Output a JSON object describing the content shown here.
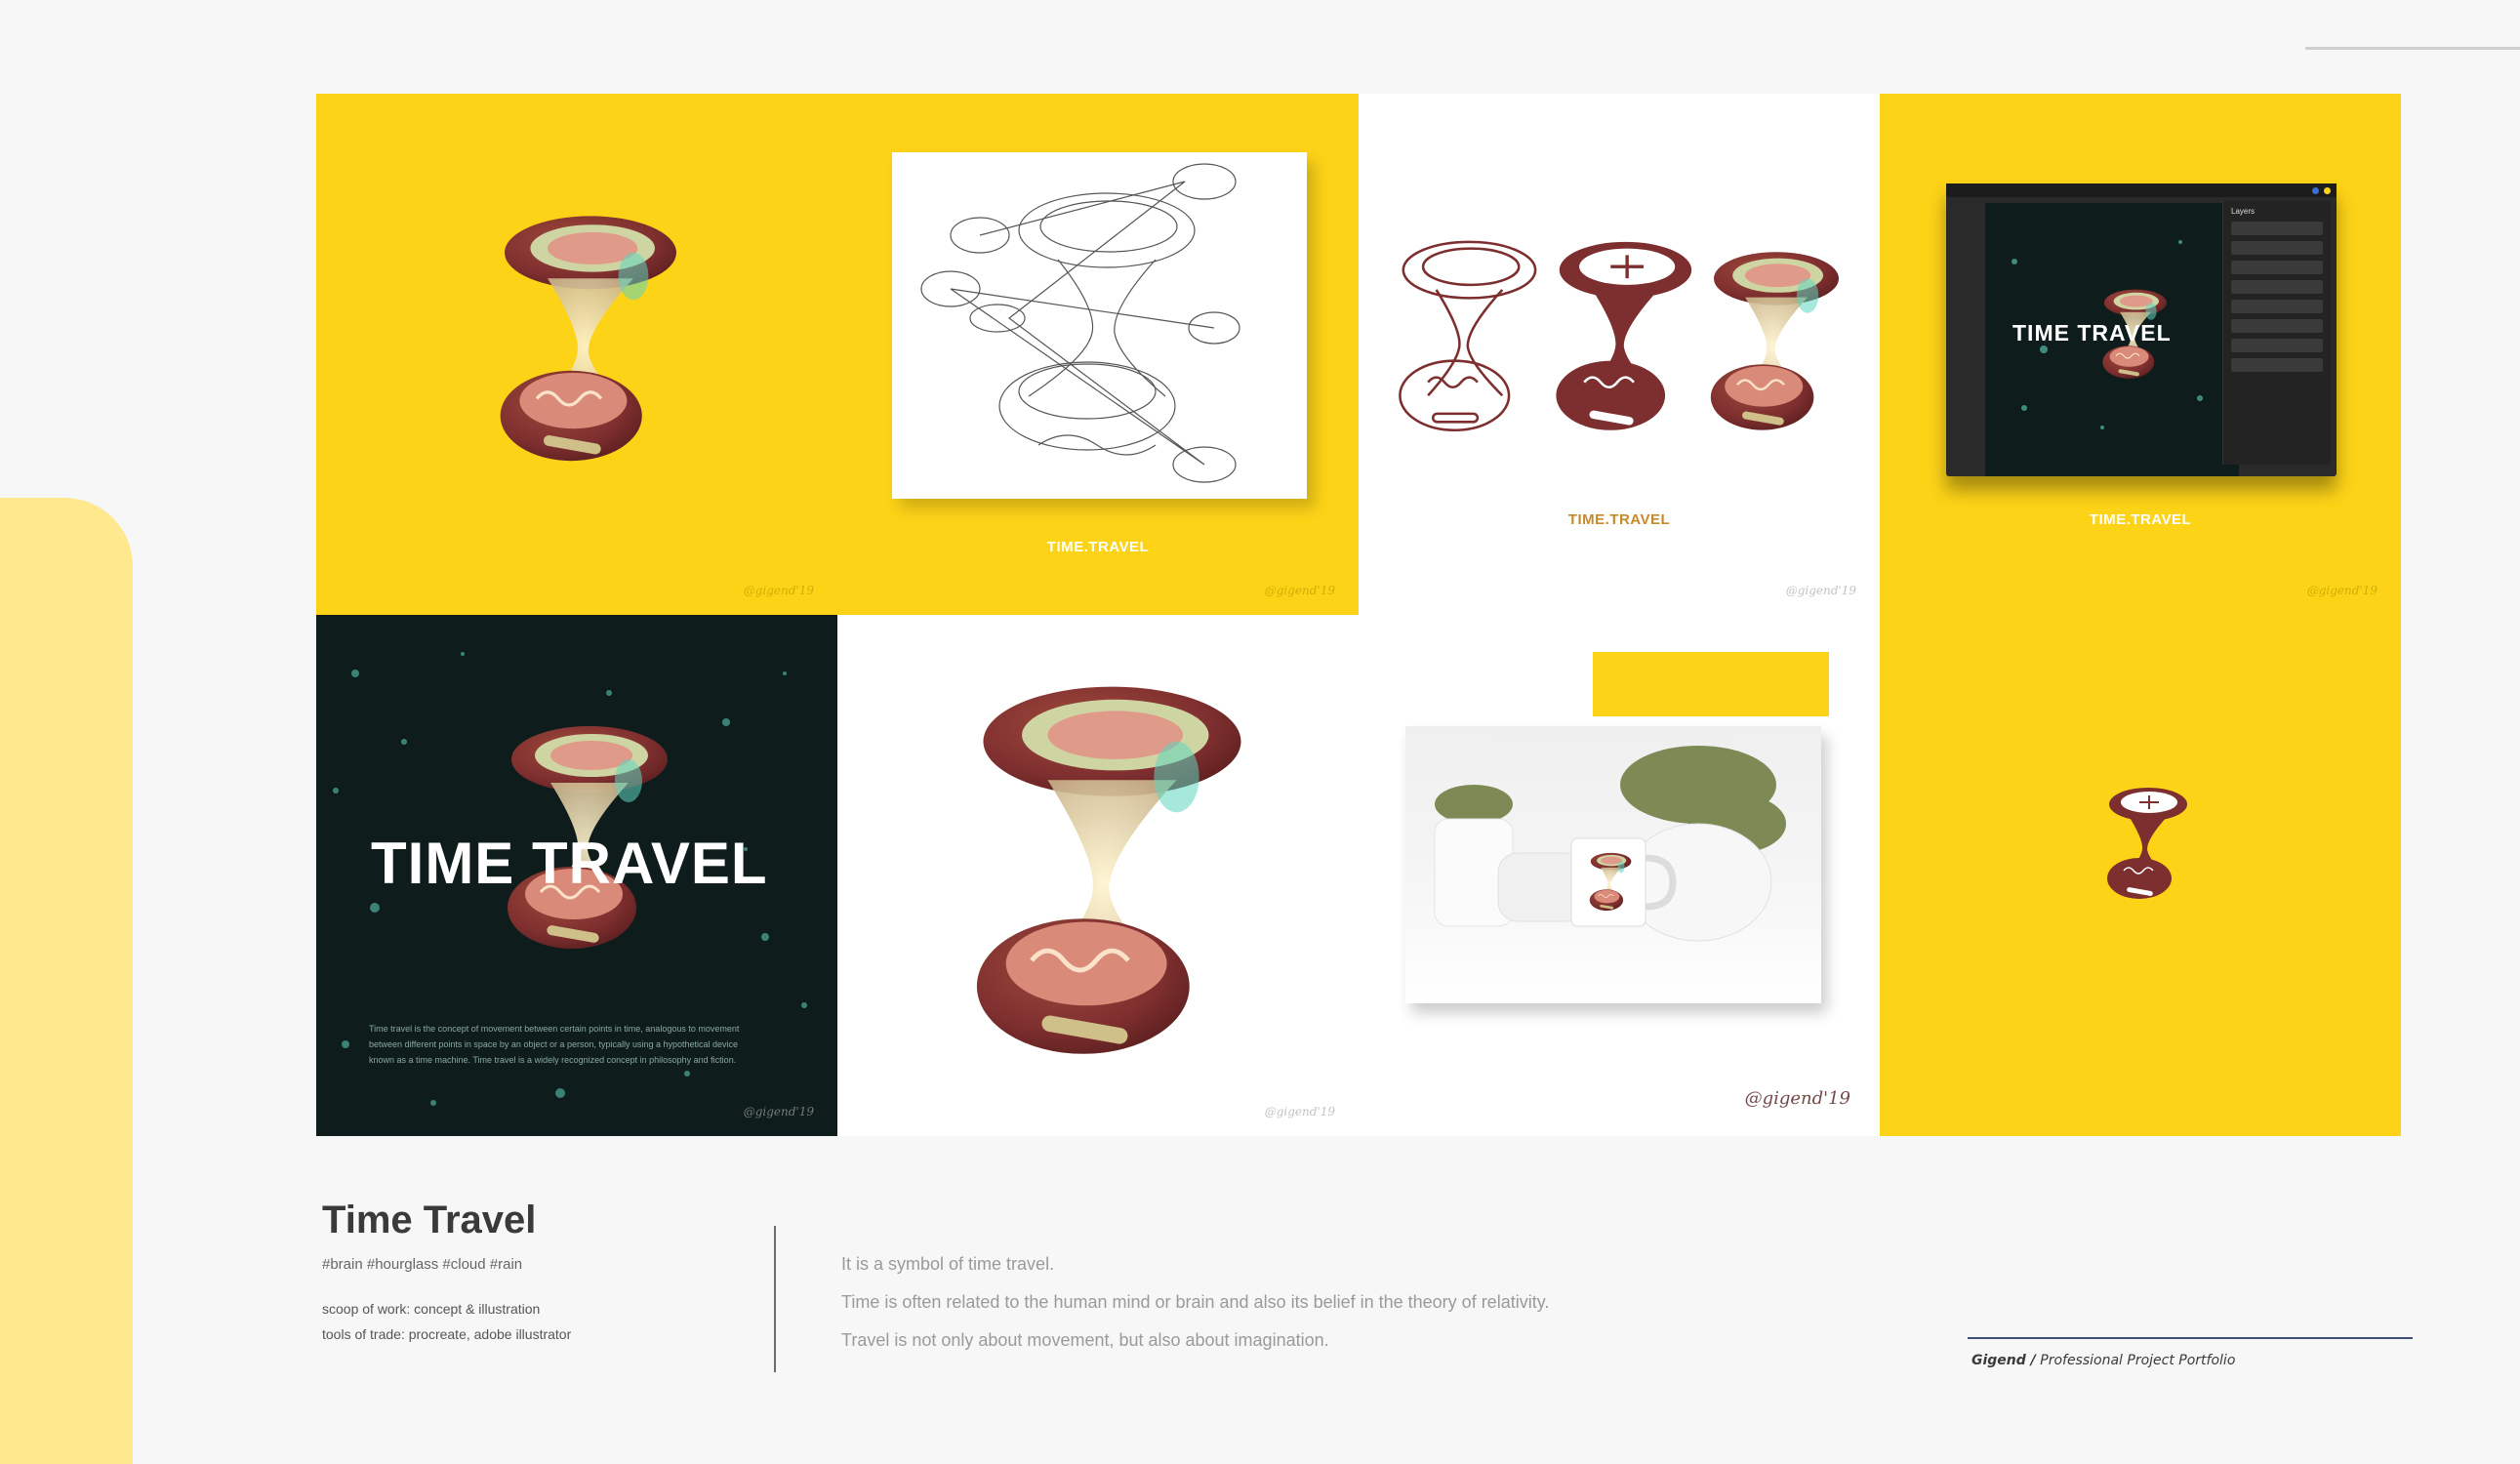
{
  "tile_label": "TIME.TRAVEL",
  "dark_title": "TIME TRAVEL",
  "tablet_title": "TIME TRAVEL",
  "tablet_layers_heading": "Layers",
  "dark_paragraph": "Time travel is the concept of movement between certain points in time, analogous to movement between different points in space by an object or a person, typically using a hypothetical device known as a time machine. Time travel is a widely recognized concept in philosophy and fiction.",
  "signature": "@gigend'19",
  "project": {
    "title": "Time Travel",
    "tags": "#brain #hourglass #cloud #rain",
    "scope": "scoop of work: concept & illustration",
    "tools": "tools of trade: procreate, adobe illustrator"
  },
  "description": [
    "It is a symbol of time travel.",
    "Time is often related to the human mind or brain and also its belief in the theory of relativity.",
    "Travel is not only about movement, but also about imagination."
  ],
  "brand": {
    "name": "Gigend /",
    "subtitle": "Professional Project Portfolio"
  },
  "colors": {
    "yellow": "#fdd318",
    "maroon": "#7d2e2e",
    "teal": "#5fd6c0",
    "dark_bg": "#0e1d1b"
  }
}
